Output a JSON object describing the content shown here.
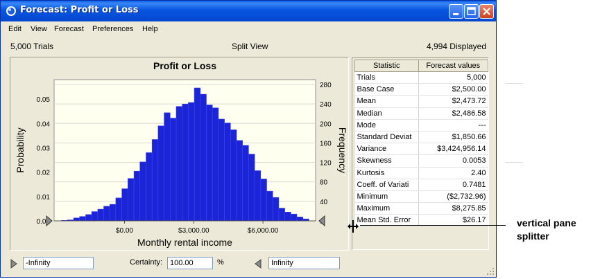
{
  "window": {
    "title": "Forecast: Profit or Loss",
    "buttons": [
      "minimize",
      "maximize",
      "close"
    ]
  },
  "menu": {
    "items": [
      "Edit",
      "View",
      "Forecast",
      "Preferences",
      "Help"
    ]
  },
  "info": {
    "trials": "5,000 Trials",
    "view": "Split View",
    "displayed": "4,994 Displayed"
  },
  "chart_data": {
    "type": "bar",
    "title": "Profit or Loss",
    "xlabel": "Monthly rental income",
    "ylabel_left": "Probability",
    "ylabel_right": "Frequency",
    "xlim": [
      -3050,
      8280
    ],
    "x_ticks": [
      "$0.00",
      "$3,000.00",
      "$6,000.00"
    ],
    "x_tick_values": [
      0,
      3000,
      6000
    ],
    "left_ticks": [
      "0.00",
      "0.01",
      "0.02",
      "0.03",
      "0.04",
      "0.05"
    ],
    "left_tick_values": [
      0,
      0.01,
      0.02,
      0.03,
      0.04,
      0.05
    ],
    "right_ticks": [
      "0",
      "40",
      "80",
      "120",
      "160",
      "200",
      "240",
      "280"
    ],
    "right_tick_values": [
      0,
      40,
      80,
      120,
      160,
      200,
      240,
      280
    ],
    "ylim_left": [
      0,
      0.058
    ],
    "ylim_right": [
      0,
      290
    ],
    "grid": true,
    "bar_color": "#1c24d8",
    "bin_starts": [
      -2730,
      -2469,
      -2207,
      -1946,
      -1684,
      -1423,
      -1161,
      -900,
      -638,
      -377,
      -115,
      146,
      408,
      669,
      931,
      1192,
      1454,
      1715,
      1977,
      2238,
      2500,
      2761,
      3023,
      3284,
      3546,
      3807,
      4069,
      4330,
      4592,
      4853,
      5115,
      5376,
      5638,
      5899,
      6161,
      6422,
      6684,
      6945,
      7207,
      7468,
      7730
    ],
    "bin_width": 261.6,
    "values": [
      1,
      2,
      6,
      9,
      13,
      19,
      24,
      30,
      34,
      47,
      66,
      87,
      102,
      121,
      140,
      167,
      195,
      222,
      211,
      235,
      240,
      243,
      273,
      260,
      238,
      232,
      209,
      201,
      187,
      165,
      155,
      137,
      103,
      86,
      61,
      48,
      26,
      18,
      14,
      8,
      4
    ]
  },
  "stats": {
    "header_statistic": "Statistic",
    "header_values": "Forecast values",
    "rows": [
      {
        "label": "Trials",
        "value": "5,000"
      },
      {
        "label": "Base Case",
        "value": "$2,500.00"
      },
      {
        "label": "Mean",
        "value": "$2,473.72"
      },
      {
        "label": "Median",
        "value": "$2,486.58"
      },
      {
        "label": "Mode",
        "value": "---"
      },
      {
        "label": "Standard Deviat",
        "value": "$1,850.66"
      },
      {
        "label": "Variance",
        "value": "$3,424,956.14"
      },
      {
        "label": "Skewness",
        "value": "0.0053"
      },
      {
        "label": "Kurtosis",
        "value": "2.40"
      },
      {
        "label": "Coeff. of Variati",
        "value": "0.7481"
      },
      {
        "label": "Minimum",
        "value": "($2,732.96)"
      },
      {
        "label": "Maximum",
        "value": "$8,275.85"
      },
      {
        "label": "Mean Std. Error",
        "value": "$26.17"
      }
    ]
  },
  "certainty": {
    "left_value": "-Infinity",
    "label": "Certainty:",
    "value": "100.00",
    "unit": "%",
    "right_value": "Infinity"
  },
  "callout": {
    "line1": "vertical pane",
    "line2": "splitter"
  }
}
